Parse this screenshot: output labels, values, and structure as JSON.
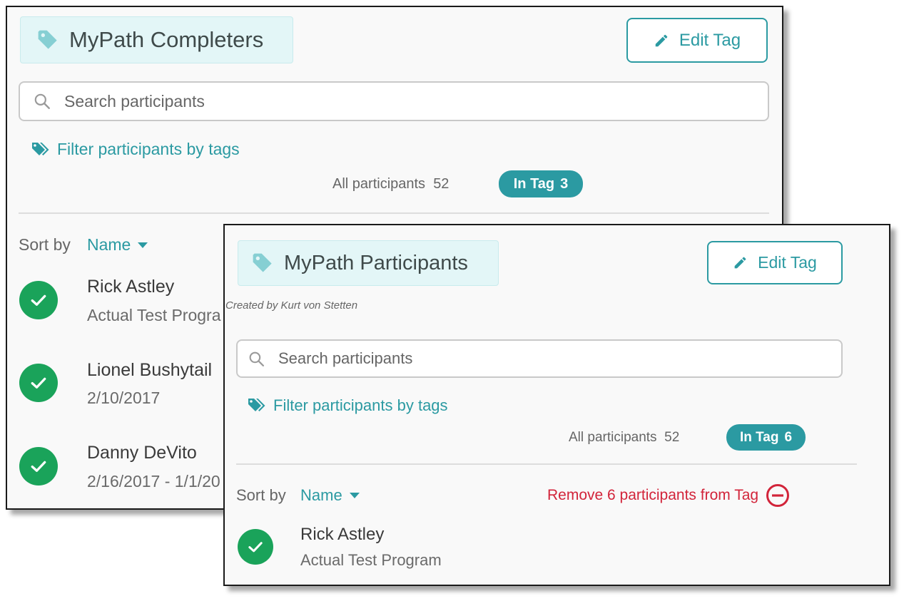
{
  "colors": {
    "accent": "#2b9aa2",
    "tag_bg": "#e3f6f7",
    "success": "#1aa35a",
    "danger": "#d2243a"
  },
  "panel_a": {
    "tag_title": "MyPath Completers",
    "edit_label": "Edit Tag",
    "search_placeholder": "Search participants",
    "filter_label": "Filter participants by tags",
    "all_label": "All participants",
    "all_count": "52",
    "in_tag_label": "In Tag",
    "in_tag_count": "3",
    "sort_label": "Sort by",
    "sort_value": "Name",
    "participants": [
      {
        "name": "Rick Astley",
        "sub": "Actual Test Progra"
      },
      {
        "name": "Lionel Bushytail",
        "sub": "2/10/2017"
      },
      {
        "name": "Danny DeVito",
        "sub": "2/16/2017 - 1/1/20"
      }
    ]
  },
  "panel_b": {
    "tag_title": "MyPath Participants",
    "created_by": "Created by Kurt von Stetten",
    "edit_label": "Edit Tag",
    "search_placeholder": "Search participants",
    "filter_label": "Filter participants by tags",
    "all_label": "All participants",
    "all_count": "52",
    "in_tag_label": "In Tag",
    "in_tag_count": "6",
    "sort_label": "Sort by",
    "sort_value": "Name",
    "remove_label": "Remove 6 participants from Tag",
    "participants": [
      {
        "name": "Rick Astley",
        "sub": "Actual Test Program"
      }
    ]
  },
  "icons": {
    "tag": "tag-icon",
    "pencil": "pencil-icon",
    "search": "search-icon",
    "tags": "tags-icon",
    "caret": "caret-down-icon",
    "check": "check-circle-icon",
    "remove": "minus-circle-icon"
  }
}
